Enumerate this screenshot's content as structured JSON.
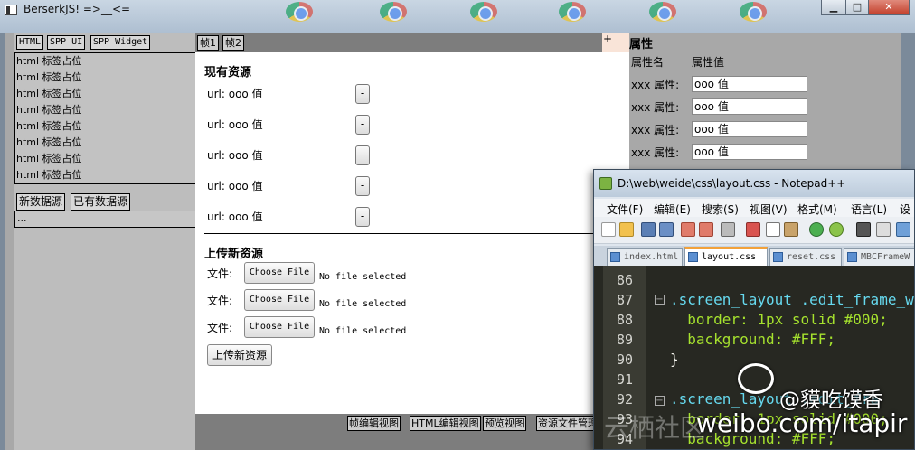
{
  "berserk": {
    "title": "BerserkJS! =>__<=",
    "controls": {
      "minimize": "▁",
      "maximize": "□",
      "close": "✕"
    },
    "left": {
      "tabs": [
        "HTML",
        "SPP UI",
        "SPP Widget"
      ],
      "html_items": [
        "html 标签占位",
        "html 标签占位",
        "html 标签占位",
        "html 标签占位",
        "html 标签占位",
        "html 标签占位",
        "html 标签占位",
        "html 标签占位"
      ],
      "datasource_tabs": [
        "新数据源",
        "已有数据源"
      ],
      "datasource_text": "..."
    },
    "center": {
      "frame_tabs": [
        "帧1",
        "帧2"
      ],
      "plus": "+",
      "existing_title": "现有资源",
      "urls": [
        "url: ooo 值",
        "url: ooo 值",
        "url: ooo 值",
        "url: ooo 值",
        "url: ooo 值"
      ],
      "minus": "-",
      "upload_title": "上传新资源",
      "file_label": "文件:",
      "choose_file": "Choose File",
      "no_file": "No file selected",
      "upload_button": "上传新资源",
      "bottom_tabs": [
        "帧编辑视图",
        "HTML编辑视图",
        "预览视图",
        "资源文件管理"
      ]
    },
    "right": {
      "title": "属性",
      "col_name": "属性名",
      "col_value": "属性值",
      "rows": [
        {
          "name": "xxx 属性:",
          "value": "ooo 值"
        },
        {
          "name": "xxx 属性:",
          "value": "ooo 值"
        },
        {
          "name": "xxx 属性:",
          "value": "ooo 值"
        },
        {
          "name": "xxx 属性:",
          "value": "ooo 值"
        }
      ]
    }
  },
  "notepad": {
    "title": "D:\\web\\weide\\css\\layout.css - Notepad++",
    "menu": [
      "文件(F)",
      "编辑(E)",
      "搜索(S)",
      "视图(V)",
      "格式(M)",
      "语言(L)",
      "设置"
    ],
    "tabs": [
      "index.html",
      "layout.css",
      "reset.css",
      "MBCFrameW"
    ],
    "active_tab": "layout.css",
    "lines": [
      {
        "n": "86",
        "text": ""
      },
      {
        "n": "87",
        "text": ".screen_layout .edit_frame_w"
      },
      {
        "n": "88",
        "text": "  border: 1px solid #000;"
      },
      {
        "n": "89",
        "text": "  background: #FFF;"
      },
      {
        "n": "90",
        "text": "}"
      },
      {
        "n": "91",
        "text": ""
      },
      {
        "n": "92",
        "text": ".screen_layout .edit_fra"
      },
      {
        "n": "93",
        "text": "  border: 1px solid #000;"
      },
      {
        "n": "94",
        "text": "  background: #FFF;"
      }
    ]
  },
  "watermark": {
    "handle": "@貘吃馍香",
    "url": "weibo.com/itapir",
    "faded": "云栖社区"
  }
}
